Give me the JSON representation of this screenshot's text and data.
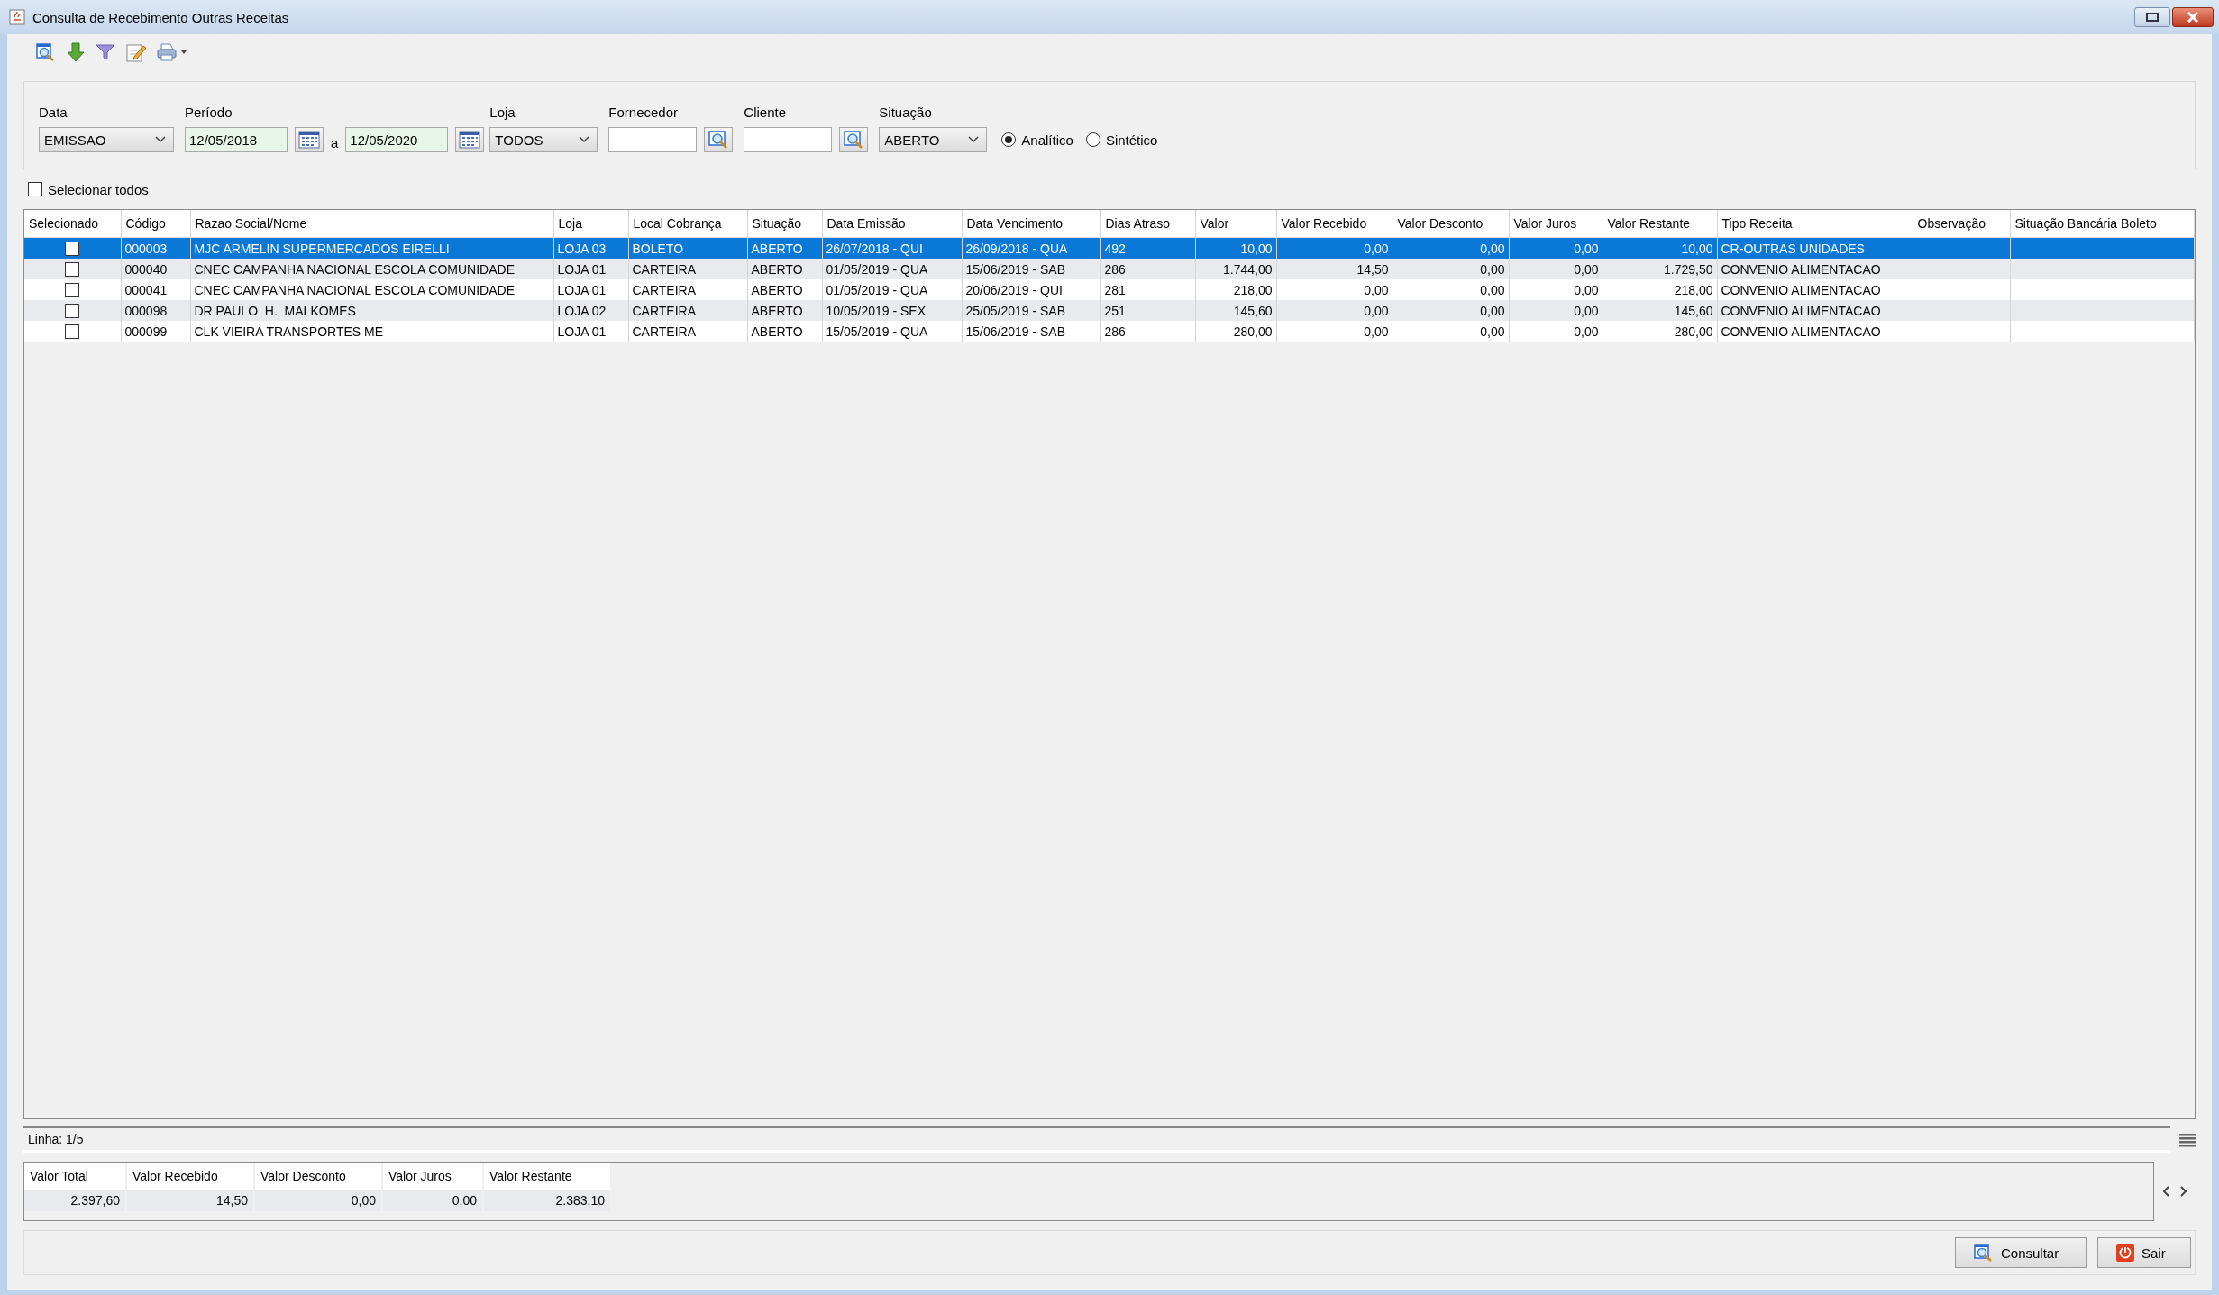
{
  "window": {
    "title": "Consulta de Recebimento Outras Receitas"
  },
  "filters": {
    "data": {
      "label": "Data",
      "value": "EMISSAO"
    },
    "periodo": {
      "label": "Período",
      "from": "12/05/2018",
      "separator": "a",
      "to": "12/05/2020"
    },
    "loja": {
      "label": "Loja",
      "value": "TODOS"
    },
    "fornecedor": {
      "label": "Fornecedor"
    },
    "cliente": {
      "label": "Cliente"
    },
    "situacao": {
      "label": "Situação",
      "value": "ABERTO"
    },
    "modes": [
      {
        "label": "Analítico",
        "selected": true
      },
      {
        "label": "Sintético",
        "selected": false
      }
    ]
  },
  "select_all": {
    "label": "Selecionar todos",
    "checked": false
  },
  "table": {
    "columns": [
      {
        "label": "Selecionado",
        "kind": "check"
      },
      {
        "label": "Código",
        "kind": "text"
      },
      {
        "label": "Razao Social/Nome",
        "kind": "text"
      },
      {
        "label": "Loja",
        "kind": "text"
      },
      {
        "label": "Local Cobrança",
        "kind": "text"
      },
      {
        "label": "Situação",
        "kind": "text"
      },
      {
        "label": "Data Emissão",
        "kind": "text"
      },
      {
        "label": "Data Vencimento",
        "kind": "text"
      },
      {
        "label": "Dias Atraso",
        "kind": "text"
      },
      {
        "label": "Valor",
        "kind": "number"
      },
      {
        "label": "Valor Recebido",
        "kind": "number"
      },
      {
        "label": "Valor Desconto",
        "kind": "number"
      },
      {
        "label": "Valor Juros",
        "kind": "number"
      },
      {
        "label": "Valor Restante",
        "kind": "number"
      },
      {
        "label": "Tipo Receita",
        "kind": "text"
      },
      {
        "label": "Observação",
        "kind": "text"
      },
      {
        "label": "Situação Bancária Boleto",
        "kind": "text"
      }
    ],
    "rows": [
      {
        "selected": true,
        "checked": false,
        "cells": [
          "",
          "000003",
          "MJC ARMELIN SUPERMERCADOS EIRELLI",
          "LOJA 03",
          "BOLETO",
          "ABERTO",
          "26/07/2018 - QUI",
          "26/09/2018 - QUA",
          "492",
          "10,00",
          "0,00",
          "0,00",
          "0,00",
          "10,00",
          "CR-OUTRAS UNIDADES"
        ]
      },
      {
        "selected": false,
        "checked": false,
        "cells": [
          "",
          "000040",
          "CNEC CAMPANHA NACIONAL ESCOLA COMUNIDADE",
          "LOJA 01",
          "CARTEIRA",
          "ABERTO",
          "01/05/2019 - QUA",
          "15/06/2019 - SAB",
          "286",
          "1.744,00",
          "14,50",
          "0,00",
          "0,00",
          "1.729,50",
          "CONVENIO ALIMENTACAO"
        ]
      },
      {
        "selected": false,
        "checked": false,
        "cells": [
          "",
          "000041",
          "CNEC CAMPANHA NACIONAL ESCOLA COMUNIDADE",
          "LOJA 01",
          "CARTEIRA",
          "ABERTO",
          "01/05/2019 - QUA",
          "20/06/2019 - QUI",
          "281",
          "218,00",
          "0,00",
          "0,00",
          "0,00",
          "218,00",
          "CONVENIO ALIMENTACAO"
        ]
      },
      {
        "selected": false,
        "checked": false,
        "cells": [
          "",
          "000098",
          "DR PAULO  H.  MALKOMES",
          "LOJA 02",
          "CARTEIRA",
          "ABERTO",
          "10/05/2019 - SEX",
          "25/05/2019 - SAB",
          "251",
          "145,60",
          "0,00",
          "0,00",
          "0,00",
          "145,60",
          "CONVENIO ALIMENTACAO"
        ]
      },
      {
        "selected": false,
        "checked": false,
        "cells": [
          "",
          "000099",
          "CLK VIEIRA TRANSPORTES ME",
          "LOJA 01",
          "CARTEIRA",
          "ABERTO",
          "15/05/2019 - QUA",
          "15/06/2019 - SAB",
          "286",
          "280,00",
          "0,00",
          "0,00",
          "0,00",
          "280,00",
          "CONVENIO ALIMENTACAO"
        ]
      }
    ]
  },
  "status": {
    "text": "Linha: 1/5"
  },
  "summary": {
    "columns": [
      "Valor Total",
      "Valor Recebido",
      "Valor Desconto",
      "Valor Juros",
      "Valor Restante"
    ],
    "values": [
      "2.397,60",
      "14,50",
      "0,00",
      "0,00",
      "2.383,10"
    ]
  },
  "buttons": [
    {
      "label": "Consultar",
      "kind": "search"
    },
    {
      "label": "Sair",
      "kind": "exit"
    }
  ]
}
